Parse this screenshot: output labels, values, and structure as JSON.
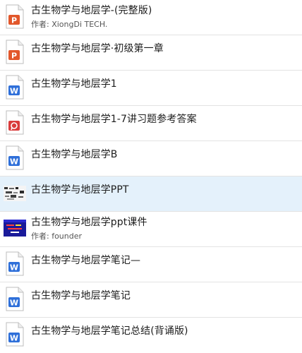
{
  "colors": {
    "selected_row": "#e4f1fb",
    "ppt_orange": "#e2572b",
    "doc_blue": "#2e6fd9",
    "pdf_red": "#d93c3c"
  },
  "author_prefix": "作者: ",
  "files": [
    {
      "title": "古生物学与地层学-(完整版)",
      "icon": "ppt-file-icon",
      "author": "XiongDi TECH."
    },
    {
      "title": "古生物学与地层学·初级第一章",
      "icon": "ppt-file-icon"
    },
    {
      "title": "古生物学与地层学1",
      "icon": "word-doc-icon"
    },
    {
      "title": "古生物学与地层学1-7讲习题参考答案",
      "icon": "pdf-file-icon"
    },
    {
      "title": "古生物学与地层学B",
      "icon": "word-doc-icon"
    },
    {
      "title": "古生物学与地层学PPT",
      "icon": "slide-thumbnail-icon",
      "selected": true
    },
    {
      "title": "古生物学与地层学ppt课件",
      "icon": "slide-thumbnail-icon",
      "author": "founder"
    },
    {
      "title": "古生物学与地层学笔记—",
      "icon": "word-doc-icon"
    },
    {
      "title": "古生物学与地层学笔记",
      "icon": "word-doc-icon"
    },
    {
      "title": "古生物学与地层学笔记总结(背诵版)",
      "icon": "word-doc-icon"
    }
  ]
}
